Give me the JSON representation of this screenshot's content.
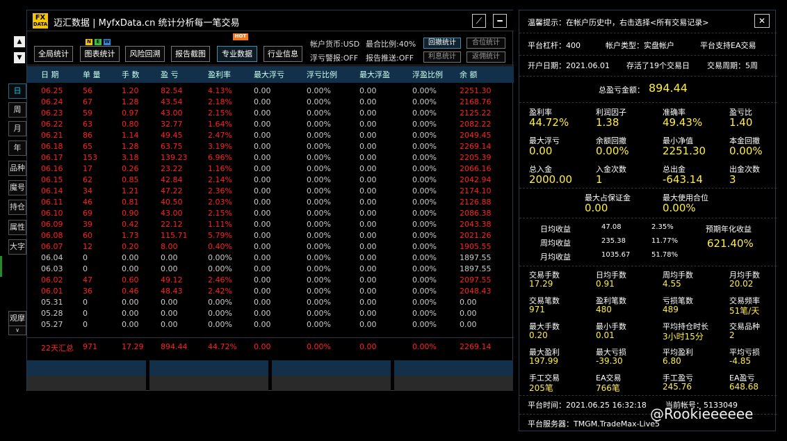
{
  "nav": {
    "up_arrow": "▲",
    "down_arrow": "▼",
    "items": [
      "日",
      "周",
      "月",
      "年",
      "品种",
      "魔号",
      "持仓",
      "属性",
      "大字",
      "观摩"
    ],
    "expand": "∨"
  },
  "window": {
    "logo_top": "FX",
    "logo_bottom": "DATA",
    "title": "迈汇数据 | MyfxData.cn  统计分析每一笔交易",
    "minimize_icon": "⟋",
    "close_icon": "━"
  },
  "toolbar": {
    "buttons": [
      "全局统计",
      "图表统计",
      "风险回溯",
      "报告截图",
      "专业数据",
      "行业信息"
    ],
    "badge_n": "N",
    "badge_e": "E",
    "badge_w": "W",
    "badge_hot": "HOT",
    "info": {
      "currency": "帐户货币:USD",
      "max_pos": "最合比例:40%",
      "float_warn": "浮亏警报:OFF",
      "report_push": "报告推送:OFF"
    },
    "info_buttons": [
      "回撤统计",
      "合位统计",
      "利息统计",
      "返佣统计"
    ]
  },
  "table": {
    "headers": [
      "日 期",
      "单 量",
      "手 数",
      "盈 亏",
      "盈利率",
      "最大浮亏",
      "浮亏比例",
      "最大浮盈",
      "浮盈比例",
      "余 额"
    ],
    "rows": [
      [
        "06.25",
        "56",
        "1.20",
        "82.54",
        "4.13%",
        "0.00",
        "0.00%",
        "0.00",
        "0.00%",
        "2251.30"
      ],
      [
        "06.24",
        "67",
        "1.28",
        "43.54",
        "2.18%",
        "0.00",
        "0.00%",
        "0.00",
        "0.00%",
        "2168.76"
      ],
      [
        "06.23",
        "59",
        "0.97",
        "43.00",
        "2.15%",
        "0.00",
        "0.00%",
        "0.00",
        "0.00%",
        "2125.22"
      ],
      [
        "06.22",
        "63",
        "0.80",
        "32.77",
        "1.64%",
        "0.00",
        "0.00%",
        "0.00",
        "0.00%",
        "2082.22"
      ],
      [
        "06.21",
        "86",
        "1.14",
        "49.45",
        "2.47%",
        "0.00",
        "0.00%",
        "0.00",
        "0.00%",
        "2049.45"
      ],
      [
        "06.18",
        "65",
        "1.28",
        "63.75",
        "3.19%",
        "0.00",
        "0.00%",
        "0.00",
        "0.00%",
        "2269.14"
      ],
      [
        "06.17",
        "153",
        "3.18",
        "139.23",
        "6.96%",
        "0.00",
        "0.00%",
        "0.00",
        "0.00%",
        "2205.39"
      ],
      [
        "06.16",
        "17",
        "0.26",
        "23.22",
        "1.16%",
        "0.00",
        "0.00%",
        "0.00",
        "0.00%",
        "2066.16"
      ],
      [
        "06.15",
        "62",
        "0.85",
        "42.84",
        "2.14%",
        "0.00",
        "0.00%",
        "0.00",
        "0.00%",
        "2042.94"
      ],
      [
        "06.14",
        "34",
        "1.21",
        "47.22",
        "2.36%",
        "0.00",
        "0.00%",
        "0.00",
        "0.00%",
        "2174.10"
      ],
      [
        "06.11",
        "46",
        "0.81",
        "40.50",
        "2.03%",
        "0.00",
        "0.00%",
        "0.00",
        "0.00%",
        "2126.88"
      ],
      [
        "06.10",
        "69",
        "0.90",
        "43.00",
        "2.15%",
        "0.00",
        "0.00%",
        "0.00",
        "0.00%",
        "2086.38"
      ],
      [
        "06.09",
        "39",
        "0.42",
        "22.12",
        "1.11%",
        "0.00",
        "0.00%",
        "0.00",
        "0.00%",
        "2043.38"
      ],
      [
        "06.08",
        "60",
        "1.73",
        "115.71",
        "5.79%",
        "0.00",
        "0.00%",
        "0.00",
        "0.00%",
        "2021.26"
      ],
      [
        "06.07",
        "12",
        "0.20",
        "8.00",
        "0.40%",
        "0.00",
        "0.00%",
        "0.00",
        "0.00%",
        "1905.55"
      ],
      [
        "06.04",
        "0",
        "0.00",
        "0.00",
        "0.00%",
        "0.00",
        "0.00%",
        "0.00",
        "0.00%",
        "1897.55"
      ],
      [
        "06.03",
        "0",
        "0.00",
        "0.00",
        "0.00%",
        "0.00",
        "0.00%",
        "0.00",
        "0.00%",
        "1897.55"
      ],
      [
        "06.02",
        "47",
        "0.60",
        "49.12",
        "2.46%",
        "0.00",
        "0.00%",
        "0.00",
        "0.00%",
        "2097.55"
      ],
      [
        "06.01",
        "36",
        "0.46",
        "48.43",
        "2.42%",
        "0.00",
        "0.00%",
        "0.00",
        "0.00%",
        "2048.43"
      ],
      [
        "05.31",
        "0",
        "0.00",
        "0.00",
        "0.00%",
        "0.00",
        "0.00%",
        "0.00",
        "0.00%",
        "0.00"
      ],
      [
        "05.28",
        "0",
        "0.00",
        "0.00",
        "0.00%",
        "0.00",
        "0.00%",
        "0.00",
        "0.00%",
        "0.00"
      ],
      [
        "05.27",
        "0",
        "0.00",
        "0.00",
        "0.00%",
        "0.00",
        "0.00%",
        "0.00",
        "0.00%",
        "0.00"
      ]
    ],
    "summary": [
      "22天汇总",
      "971",
      "17.29",
      "894.44",
      "44.72%",
      "0.00",
      "0.00%",
      "0.00",
      "0.00%",
      "2269.14"
    ]
  },
  "panel": {
    "tip": "温馨提示：在帐户历史中，右击选择<所有交易记录>",
    "close_icon": "✕",
    "leverage": "平台杠杆：400",
    "acct_type": "帐户类型：实盘帐户",
    "ea_support": "平台支持EA交易",
    "open_date": "开户日期：2021.06.01",
    "trade_days": "存活了19个交易日",
    "cycle": "交易周期：5周",
    "total_pl_label": "总盈亏金额：",
    "total_pl": "894.44",
    "grid1": [
      {
        "label": "盈利率",
        "value": "44.72%"
      },
      {
        "label": "利润因子",
        "value": "1.38"
      },
      {
        "label": "准确率",
        "value": "49.43%"
      },
      {
        "label": "盈亏比",
        "value": "1.40"
      },
      {
        "label": "最大浮亏",
        "value": "0.00"
      },
      {
        "label": "余额回撤",
        "value": "0.00%"
      },
      {
        "label": "最小净值",
        "value": "2251.30"
      },
      {
        "label": "本金回撤",
        "value": "0.00%"
      },
      {
        "label": "总入金",
        "value": "2000.00"
      },
      {
        "label": "入金次数",
        "value": "1"
      },
      {
        "label": "总出金",
        "value": "-643.14"
      },
      {
        "label": "出金次数",
        "value": "3"
      }
    ],
    "margin": [
      {
        "label": "最大占保证金",
        "value": "0.00"
      },
      {
        "label": "最大使用合位",
        "value": "0.00%"
      }
    ],
    "avg": [
      {
        "label": "日均收益",
        "value": "47.08",
        "pct": "2.35%"
      },
      {
        "label": "周均收益",
        "value": "235.38",
        "pct": "11.77%"
      },
      {
        "label": "月均收益",
        "value": "1035.67",
        "pct": "51.78%"
      }
    ],
    "annual_label": "预期年化收益",
    "annual_value": "621.40%",
    "grid2": [
      {
        "label": "交易手数",
        "value": "17.29"
      },
      {
        "label": "日均手数",
        "value": "0.91"
      },
      {
        "label": "周均手数",
        "value": "4.55"
      },
      {
        "label": "月均手数",
        "value": "20.02"
      },
      {
        "label": "交易笔数",
        "value": "971"
      },
      {
        "label": "盈利笔数",
        "value": "480"
      },
      {
        "label": "亏损笔数",
        "value": "489"
      },
      {
        "label": "交易频率",
        "value": "51笔/天"
      },
      {
        "label": "最大手数",
        "value": "0.20"
      },
      {
        "label": "最小手数",
        "value": "0.01"
      },
      {
        "label": "平均持仓时长",
        "value": "3小时15分"
      },
      {
        "label": "交易品种",
        "value": "2"
      },
      {
        "label": "最大盈利",
        "value": "197.99"
      },
      {
        "label": "最大亏损",
        "value": "-39.30"
      },
      {
        "label": "平均盈利",
        "value": "6.80"
      },
      {
        "label": "平均亏损",
        "value": "-4.85"
      },
      {
        "label": "手工交易",
        "value": "205笔"
      },
      {
        "label": "EA交易",
        "value": "766笔"
      },
      {
        "label": "手工盈亏",
        "value": "245.76"
      },
      {
        "label": "EA盈亏",
        "value": "648.68"
      }
    ],
    "platform_time": "平台时间：2021.06.25 16:32:18",
    "account_no": "当前帐号：5133049",
    "server": "平台服务器：TMGM.TradeMax-Live5"
  },
  "watermark": "@Rookieeeeee",
  "colors": {
    "accent": "#12304a",
    "loss": "#ff2020",
    "value": "#ffee44"
  }
}
